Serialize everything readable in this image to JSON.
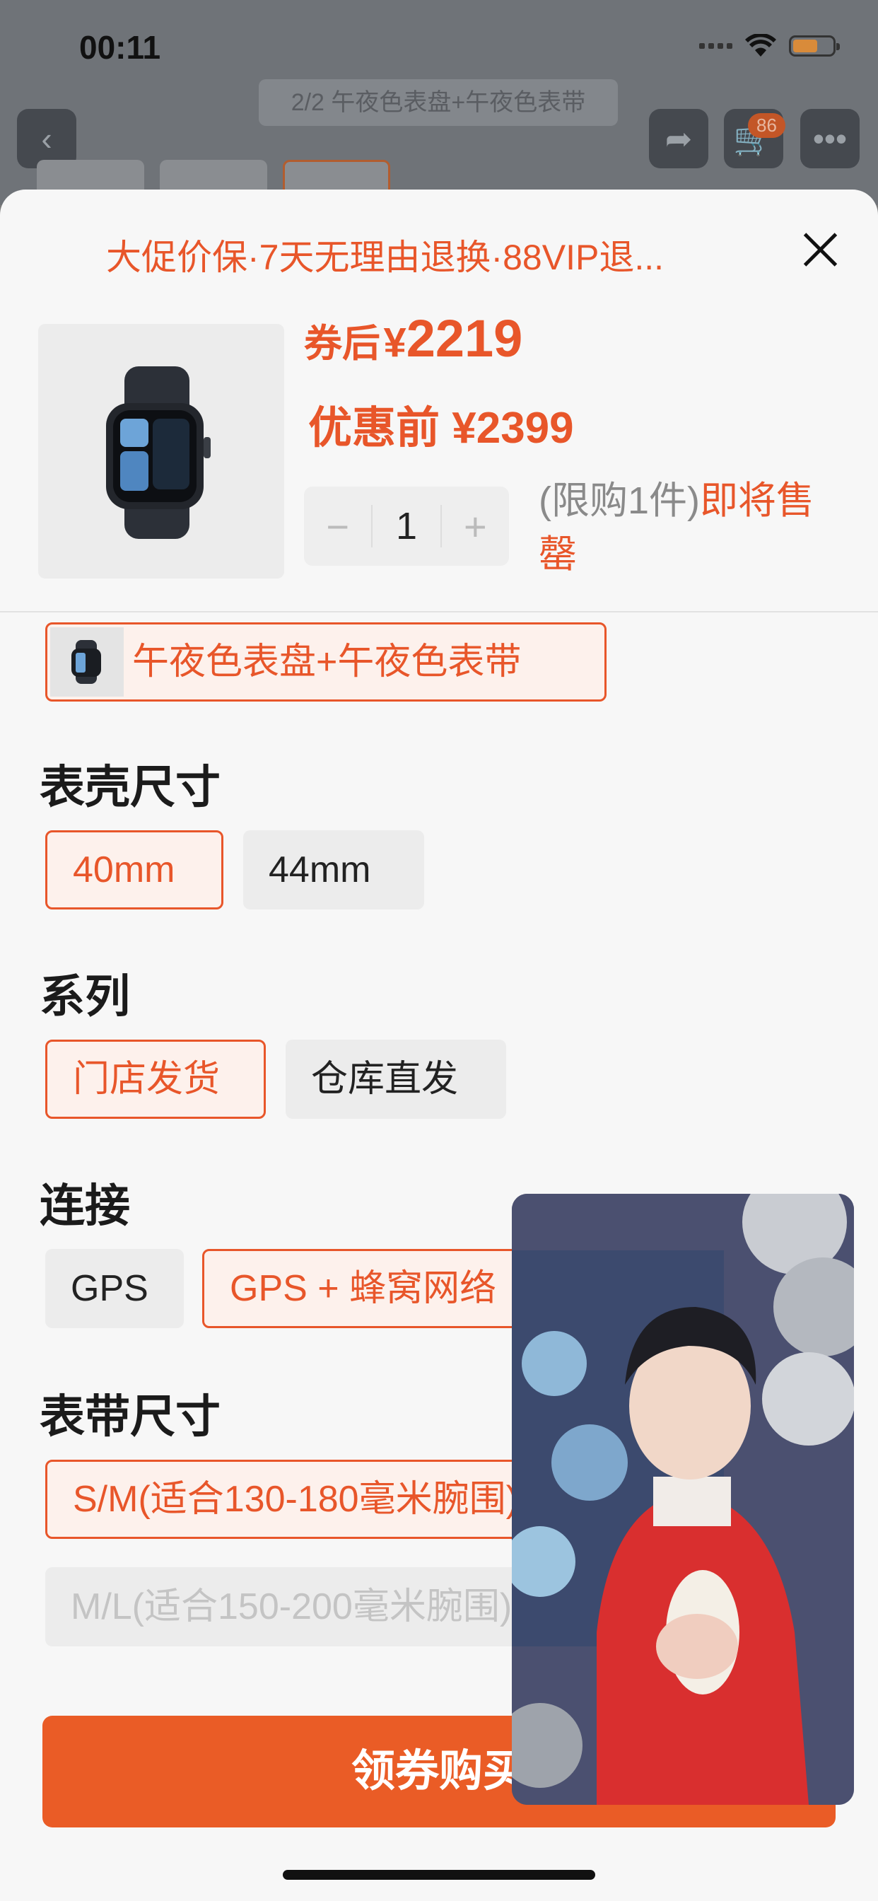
{
  "status_bar": {
    "time": "00:11"
  },
  "background": {
    "gallery_title": "2/2 午夜色表盘+午夜色表带",
    "cart_count": "86"
  },
  "sheet": {
    "promo_text": "大促价保·7天无理由退换·88VIP退...",
    "price": {
      "label": "券后",
      "symbol": "¥",
      "value": "2219"
    },
    "price_before": "优惠前 ¥2399",
    "quantity": {
      "minus": "−",
      "value": "1",
      "plus": "+"
    },
    "limit_text": "(限购1件)",
    "limit_warning": "即将售罄",
    "variant_label": "午夜色表盘+午夜色表带",
    "sections": {
      "case_size": {
        "title": "表壳尺寸",
        "options": [
          "40mm",
          "44mm"
        ]
      },
      "series": {
        "title": "系列",
        "options": [
          "门店发货",
          "仓库直发"
        ]
      },
      "connectivity": {
        "title": "连接",
        "options": [
          "GPS",
          "GPS + 蜂窝网络"
        ]
      },
      "band_size": {
        "title": "表带尺寸",
        "options": [
          "S/M(适合130-180毫米腕围)",
          "M/L(适合150-200毫米腕围)"
        ]
      }
    },
    "buy_button": "领券购买"
  },
  "colors": {
    "accent": "#e8562a",
    "button": "#ea5c26"
  }
}
